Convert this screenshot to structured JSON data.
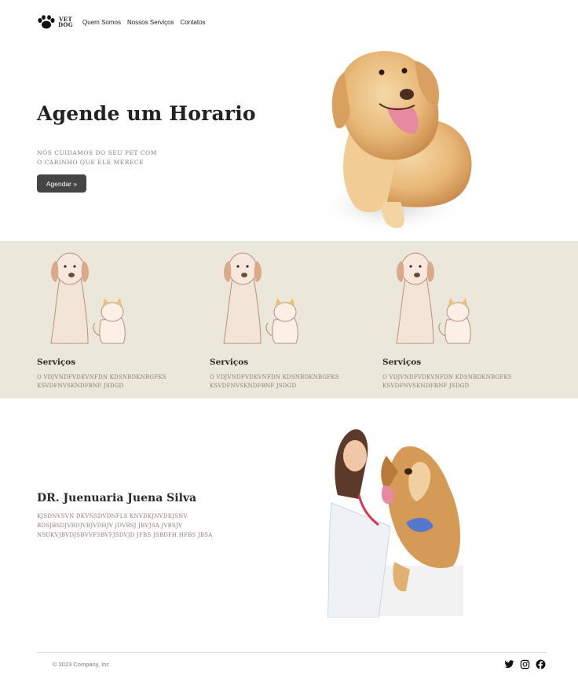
{
  "nav": {
    "logo_top": "VET",
    "logo_bottom": "DOG",
    "links": [
      "Quem Somos",
      "Nossos Serviços",
      "Contatos"
    ]
  },
  "hero": {
    "title": "Agende um Horario",
    "subtitle_line1": "NÓS CUIDAMOS DO SEU PET COM",
    "subtitle_line2": "O CARINHO QUE ELE MERECE",
    "button": "Agendar »"
  },
  "services": [
    {
      "title": "Serviços",
      "text": "O VDJVNDFVDKVNFDN KDSNBDKNBGFKS KSVDFNVSKNDFBNF JSDGD"
    },
    {
      "title": "Serviços",
      "text": "O VDJVNDFVDKVNFDN KDSNBDKNBGFKS KSVDFNVSKNDFBNF JSDGD"
    },
    {
      "title": "Serviços",
      "text": "O VDJVNDFVDKVNFDN KDSNBDKNBGFKS KSVDFNVSKNDFBNF JSDGD"
    }
  ],
  "doctor": {
    "name": "DR. Juenuaria Juena Silva",
    "text": "KJSDNVSVN DKVNSDVDNFLS KNVDKJNVDKJSNV BDSJBSDJVBDJVBJVDHJV JDVBSJ JBVJSA JVBSJV NSDKVJBVDJSBVVFSBVFJSDVJD JFBS JSBDFH HFBS JBSA"
  },
  "footer": {
    "copyright": "© 2023 Company, Inc"
  },
  "colors": {
    "band": "#ebe7da",
    "button": "#454545"
  }
}
